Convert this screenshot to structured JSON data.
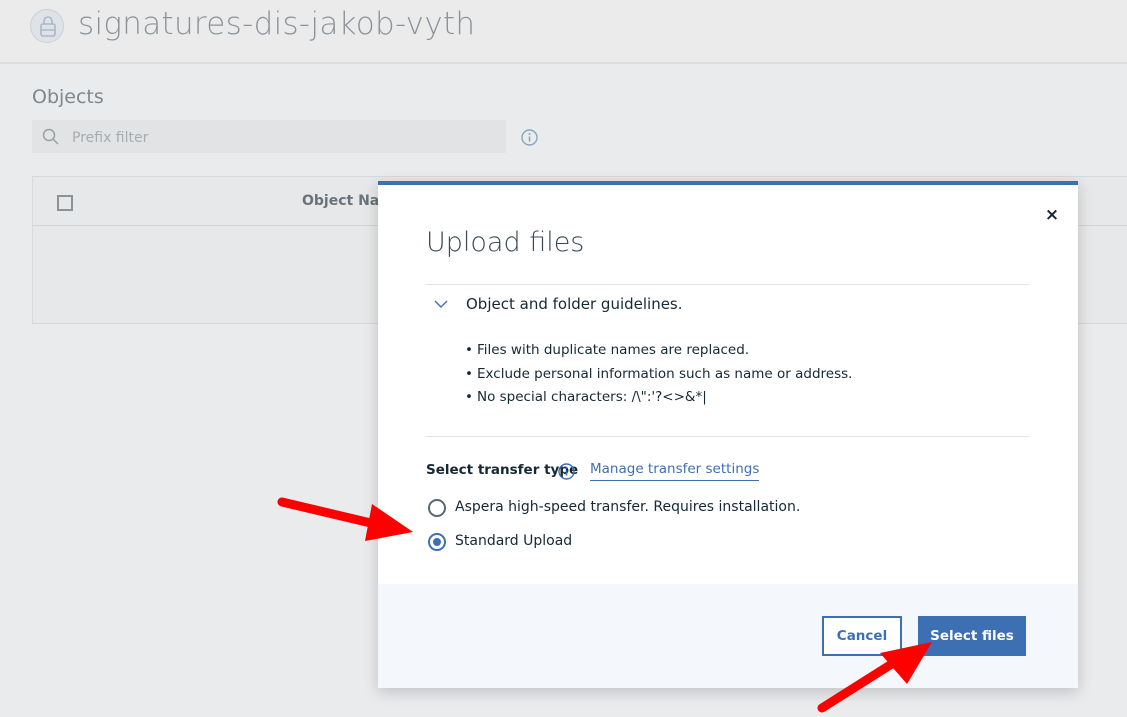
{
  "header": {
    "bucket_name": "signatures-dis-jakob-vyth"
  },
  "objects": {
    "heading": "Objects",
    "filter_placeholder": "Prefix filter",
    "column_object_name": "Object Name"
  },
  "modal": {
    "title": "Upload files",
    "close_label": "×",
    "accordion_title": "Object and folder guidelines.",
    "guidelines": [
      "Files with duplicate names are replaced.",
      "Exclude personal information such as name or address.",
      "No special characters: /\\\":'?<>&*|"
    ],
    "transfer_label": "Select transfer type",
    "manage_link": "Manage transfer settings",
    "options": [
      {
        "label": "Aspera high-speed transfer. Requires installation.",
        "selected": false
      },
      {
        "label": "Standard Upload",
        "selected": true
      }
    ],
    "cancel_label": "Cancel",
    "primary_label": "Select files"
  },
  "colors": {
    "accent": "#3d70b2",
    "annotation_arrow": "#ff0000"
  }
}
